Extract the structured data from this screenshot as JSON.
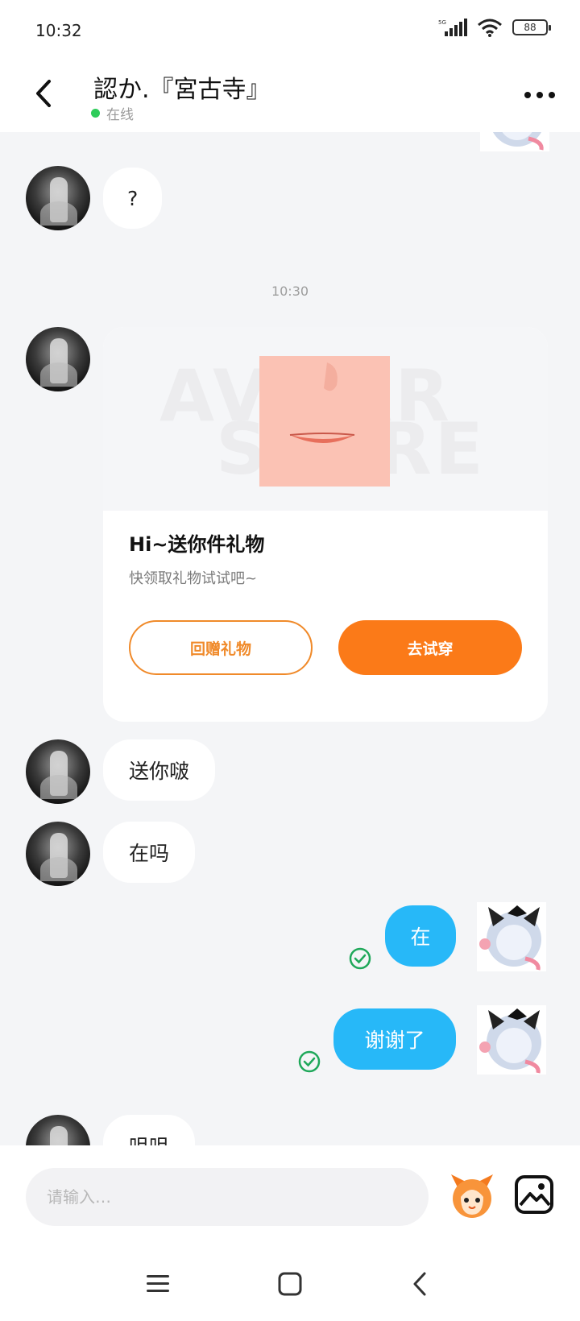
{
  "status_bar": {
    "time": "10:32",
    "network": "5G",
    "battery": "88"
  },
  "header": {
    "title": "認か.『宮古寺』",
    "presence": "在线"
  },
  "messages": {
    "m1": "?",
    "timestamp": "10:30",
    "gift": {
      "title": "Hi~送你件礼物",
      "subtitle": "快领取礼物试试吧~",
      "return_label": "回赠礼物",
      "try_label": "去试穿"
    },
    "m2": "送你啵",
    "m3": "在吗",
    "m4": "在",
    "m5": "谢谢了",
    "m6": "咀咀"
  },
  "input": {
    "placeholder": "请输入…"
  },
  "colors": {
    "accent": "#27b8f8",
    "orange": "#fb7a18",
    "online": "#2ecc5a"
  },
  "icons": [
    "back-icon",
    "more-icon",
    "emoji-icon",
    "image-icon",
    "read-check-icon",
    "menu-icon",
    "home-icon",
    "back-nav-icon"
  ]
}
